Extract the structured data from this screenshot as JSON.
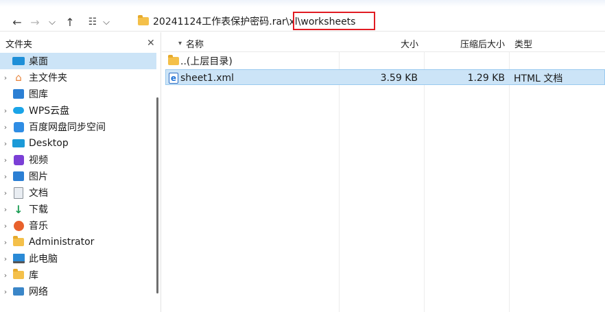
{
  "toolbar": {
    "back_icon": "←",
    "forward_icon": "→",
    "recent_icon": "⌵",
    "up_icon": "↑",
    "view_icon": "☷",
    "view_dropdown_icon": "⌵"
  },
  "address": {
    "path": "20241124工作表保护密码.rar\\xl\\worksheets"
  },
  "sidebar": {
    "title": "文件夹",
    "close": "✕",
    "items": [
      {
        "label": "桌面",
        "icon": "desktop-icon",
        "chev": ""
      },
      {
        "label": "主文件夹",
        "icon": "home-icon",
        "chev": "›"
      },
      {
        "label": "图库",
        "icon": "gallery-icon",
        "chev": ""
      },
      {
        "label": "WPS云盘",
        "icon": "cloud-icon",
        "chev": "›"
      },
      {
        "label": "百度网盘同步空间",
        "icon": "baidu-icon",
        "chev": "›"
      },
      {
        "label": "Desktop",
        "icon": "desktop-folder-icon",
        "chev": "›"
      },
      {
        "label": "视频",
        "icon": "video-icon",
        "chev": "›"
      },
      {
        "label": "图片",
        "icon": "picture-icon",
        "chev": "›"
      },
      {
        "label": "文档",
        "icon": "document-icon",
        "chev": "›"
      },
      {
        "label": "下载",
        "icon": "download-icon",
        "chev": "›"
      },
      {
        "label": "音乐",
        "icon": "music-icon",
        "chev": "›"
      },
      {
        "label": "Administrator",
        "icon": "folder-icon",
        "chev": "›"
      },
      {
        "label": "此电脑",
        "icon": "computer-icon",
        "chev": "›"
      },
      {
        "label": "库",
        "icon": "library-icon",
        "chev": "›"
      },
      {
        "label": "网络",
        "icon": "network-icon",
        "chev": "›"
      }
    ]
  },
  "list": {
    "columns": {
      "sort_arrow": "▾",
      "name": "名称",
      "size": "大小",
      "compressed": "压缩后大小",
      "type": "类型"
    },
    "rows": [
      {
        "name": "..(上层目录)",
        "size": "",
        "compressed": "",
        "type": ""
      },
      {
        "name": "sheet1.xml",
        "size": "3.59 KB",
        "compressed": "1.29 KB",
        "type": "HTML 文档"
      }
    ]
  },
  "colors": {
    "selection": "#cce4f7",
    "highlight_border": "#e11b22"
  }
}
